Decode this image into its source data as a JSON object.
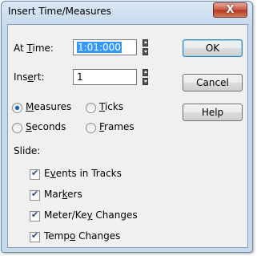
{
  "window": {
    "title": "Insert Time/Measures",
    "close_label": "X"
  },
  "fields": {
    "at_time": {
      "label_pre": "At ",
      "label_key": "T",
      "label_post": "ime:",
      "value": "1:01:000"
    },
    "insert": {
      "label_pre": "Ins",
      "label_key": "e",
      "label_post": "rt:",
      "value": "1"
    }
  },
  "buttons": {
    "ok": "OK",
    "cancel": "Cancel",
    "help": "Help"
  },
  "units": {
    "measures": {
      "key": "M",
      "rest": "easures",
      "selected": true
    },
    "ticks": {
      "key": "T",
      "rest": "icks",
      "selected": false
    },
    "seconds": {
      "key": "S",
      "rest": "econds",
      "selected": false
    },
    "frames": {
      "key": "F",
      "rest": "rames",
      "selected": false
    }
  },
  "slide": {
    "heading": "Slide:",
    "items": [
      {
        "pre": "E",
        "key": "v",
        "post": "ents in Tracks",
        "checked": true
      },
      {
        "pre": "Mar",
        "key": "k",
        "post": "ers",
        "checked": true
      },
      {
        "pre": "Meter/Ke",
        "key": "y",
        "post": " Changes",
        "checked": true
      },
      {
        "pre": "Temp",
        "key": "o",
        "post": " Changes",
        "checked": true
      }
    ]
  }
}
